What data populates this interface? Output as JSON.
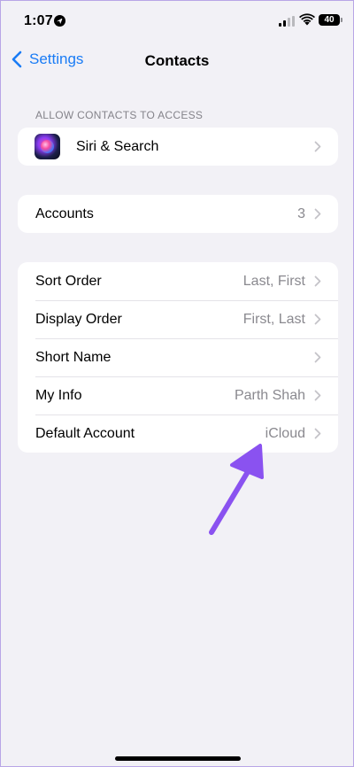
{
  "status_bar": {
    "time": "1:07",
    "battery": "40"
  },
  "nav": {
    "back_label": "Settings",
    "title": "Contacts"
  },
  "section_header": "ALLOW CONTACTS TO ACCESS",
  "siri_row": {
    "label": "Siri & Search"
  },
  "accounts_row": {
    "label": "Accounts",
    "value": "3"
  },
  "settings_rows": [
    {
      "label": "Sort Order",
      "value": "Last, First"
    },
    {
      "label": "Display Order",
      "value": "First, Last"
    },
    {
      "label": "Short Name",
      "value": ""
    },
    {
      "label": "My Info",
      "value": "Parth Shah"
    },
    {
      "label": "Default Account",
      "value": "iCloud"
    }
  ],
  "colors": {
    "accent": "#1a7cf5",
    "background": "#f2f1f6",
    "annotation_arrow": "#8a52f0"
  },
  "icons": [
    "location-icon",
    "signal-icon",
    "wifi-icon",
    "battery-icon",
    "chevron-left-icon",
    "siri-icon",
    "chevron-right-icon"
  ]
}
